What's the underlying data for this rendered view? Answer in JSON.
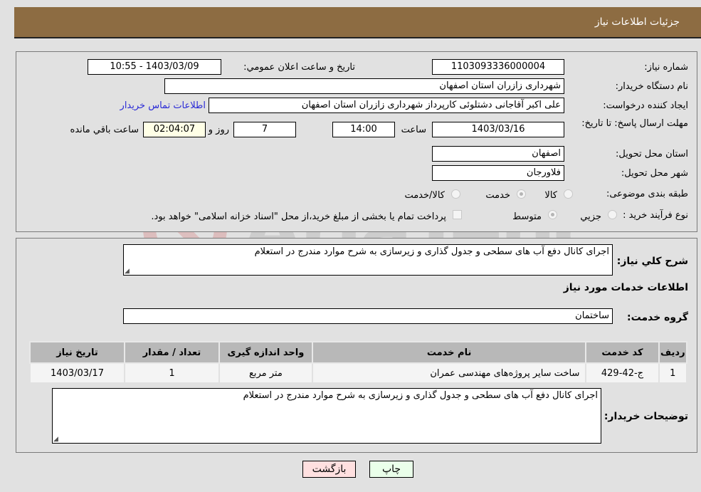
{
  "header": {
    "title": "جزئیات اطلاعات نیاز"
  },
  "details": {
    "need_number_label": "شماره نیاز:",
    "need_number": "1103093336000004",
    "announce_label": "تاریخ و ساعت اعلان عمومي:",
    "announce_value": "1403/03/09 - 10:55",
    "buyer_org_label": "نام دستگاه خریدار:",
    "buyer_org": "شهرداری زازران استان اصفهان",
    "requester_label": "ایجاد کننده درخواست:",
    "requester": "علی اکبر آقاجانی دشتلوئی کارپرداز شهرداری زازران استان اصفهان",
    "buyer_contact_link": "اطلاعات تماس خریدار",
    "deadline_label": "مهلت ارسال پاسخ: تا تاریخ:",
    "deadline_date": "1403/03/16",
    "time_label": "ساعت",
    "deadline_time": "14:00",
    "days_value": "7",
    "days_label": "روز و",
    "remaining_time": "02:04:07",
    "remaining_label": "ساعت باقي مانده",
    "province_label": "استان محل تحویل:",
    "province": "اصفهان",
    "city_label": "شهر محل تحویل:",
    "city": "فلاورجان",
    "category_label": "طبقه بندی موضوعی:",
    "category_options": [
      {
        "label": "کالا",
        "checked": false
      },
      {
        "label": "خدمت",
        "checked": true
      },
      {
        "label": "کالا/خدمت",
        "checked": false
      }
    ],
    "process_label": "نوع فرآیند خرید :",
    "process_options": [
      {
        "label": "جزيي",
        "checked": false
      },
      {
        "label": "متوسط",
        "checked": true
      }
    ],
    "treasury_checkbox_label": "پرداخت تمام یا بخشی از مبلغ خرید،از محل \"اسناد خزانه اسلامی\" خواهد بود.",
    "treasury_checked": false
  },
  "section2": {
    "summary_label": "شرح کلي نیاز:",
    "summary": "اجرای کانال دفع آب های سطحی و جدول گذاری و زیرسازی به شرح موارد مندرج در استعلام",
    "services_heading": "اطلاعات خدمات مورد نیاز",
    "service_group_label": "گروه خدمت:",
    "service_group": "ساختمان",
    "table": {
      "headers": [
        "ردیف",
        "کد خدمت",
        "نام خدمت",
        "واحد اندازه گیری",
        "تعداد / مقدار",
        "تاریخ نیاز"
      ],
      "rows": [
        [
          "1",
          "ج-42-429",
          "ساخت سایر پروژه‌های مهندسی عمران",
          "متر مربع",
          "1",
          "1403/03/17"
        ]
      ]
    },
    "buyer_notes_label": "توضیحات خریدار:",
    "buyer_notes": "اجرای کانال دفع آب های سطحی و جدول گذاری و زیرسازی به شرح موارد مندرج در استعلام"
  },
  "buttons": {
    "print": "چاپ",
    "back": "بازگشت"
  },
  "colors": {
    "header_bg": "#8d6c42",
    "print_bg": "#eaffea",
    "back_bg": "#ffe0e0",
    "link": "#2a2ad6"
  }
}
